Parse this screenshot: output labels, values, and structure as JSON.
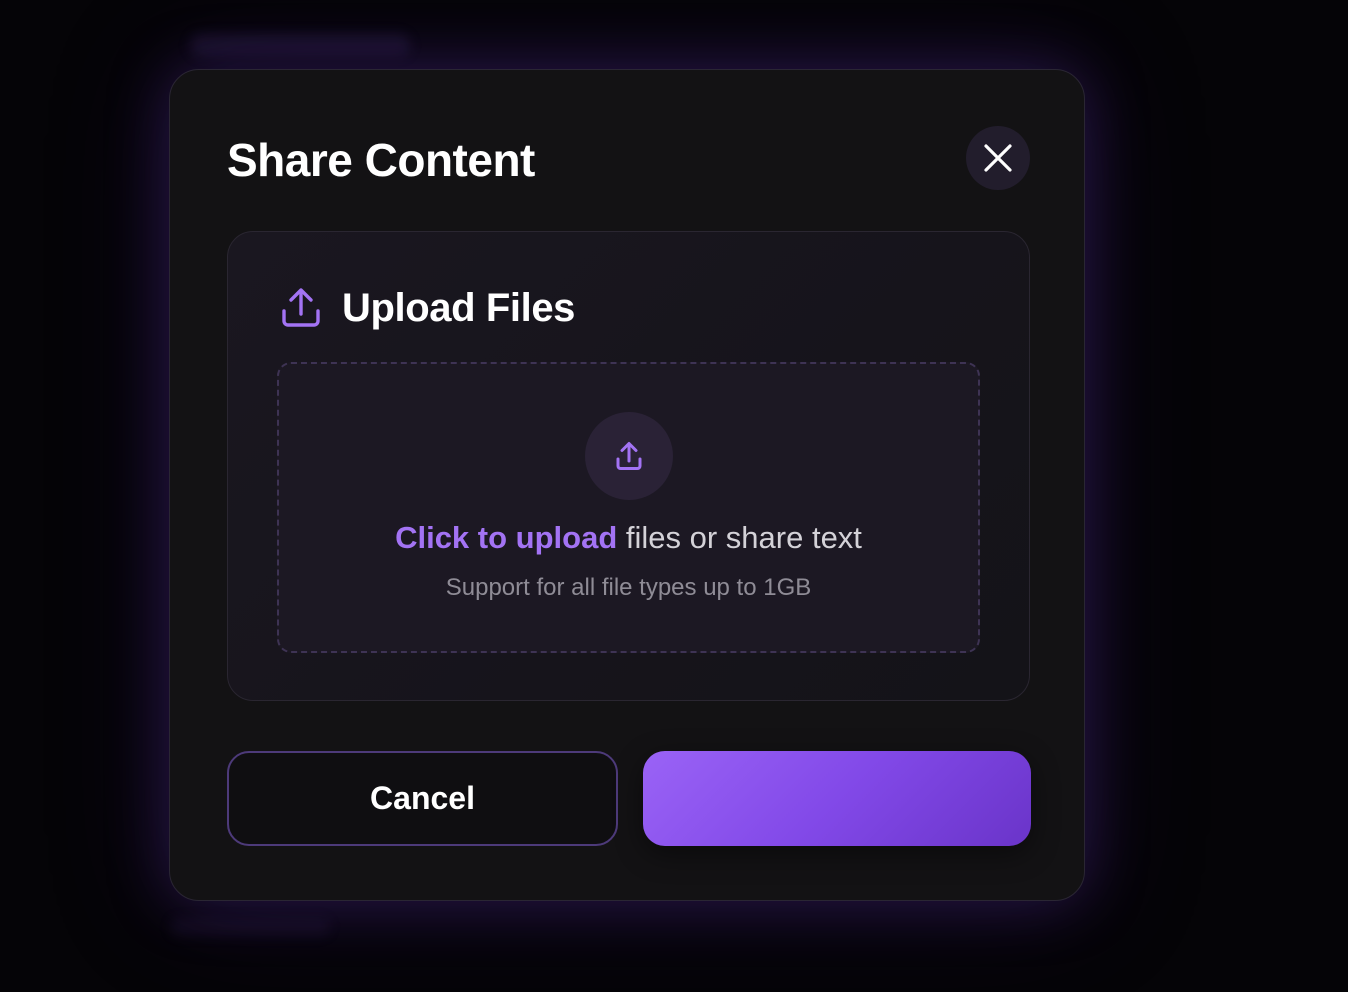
{
  "modal": {
    "title": "Share Content",
    "close_icon": "close-icon"
  },
  "upload": {
    "header_icon": "upload-icon",
    "title": "Upload Files",
    "dropzone_icon": "upload-icon",
    "link_text": "Click to upload",
    "rest_text": " files or share text",
    "subtext": "Support for all file types up to 1GB"
  },
  "actions": {
    "cancel_label": "Cancel",
    "primary_label": ""
  },
  "colors": {
    "accent": "#a373f4",
    "primary_gradient_start": "#9a63f6",
    "primary_gradient_end": "#6a34c9",
    "modal_background": "#131214",
    "page_background": "#050407"
  }
}
